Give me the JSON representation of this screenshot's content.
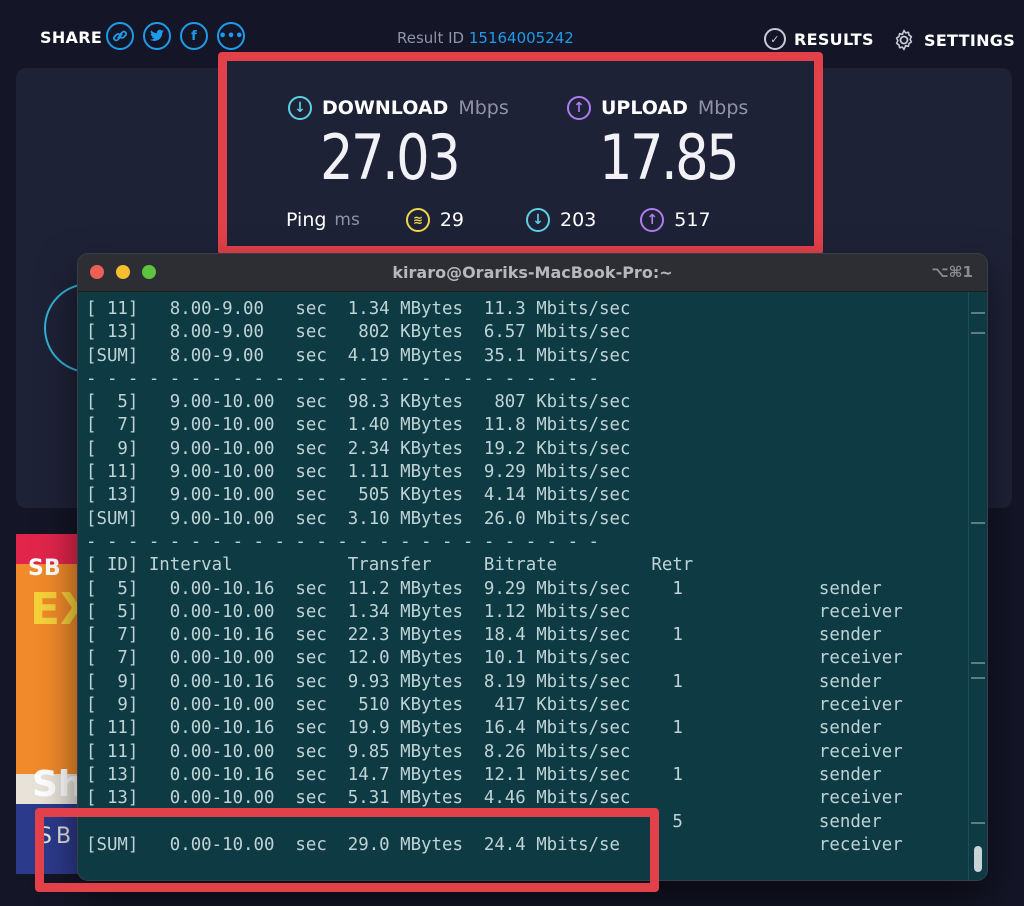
{
  "topbar": {
    "share_label": "SHARE",
    "share_icons": [
      "link-icon",
      "twitter-icon",
      "facebook-icon",
      "more-icon"
    ],
    "result_id_label": "Result ID",
    "result_id_value": "15164005242",
    "results_label": "RESULTS",
    "settings_label": "SETTINGS"
  },
  "speed": {
    "download_label": "DOWNLOAD",
    "download_unit": "Mbps",
    "download_value": "27.03",
    "upload_label": "UPLOAD",
    "upload_unit": "Mbps",
    "upload_value": "17.85",
    "ping_label": "Ping",
    "ping_unit": "ms",
    "ping_idle": "29",
    "ping_download": "203",
    "ping_upload": "517"
  },
  "ad": {
    "text_top": "SB",
    "text_big": "EX",
    "text_sh": "Sh",
    "text_bottom": "SBI"
  },
  "terminal": {
    "title": "kiraro@Orariks-MacBook-Pro:~",
    "shortcut": "⌥⌘1",
    "lines": [
      "[ 11]   8.00-9.00   sec  1.34 MBytes  11.3 Mbits/sec",
      "[ 13]   8.00-9.00   sec   802 KBytes  6.57 Mbits/sec",
      "[SUM]   8.00-9.00   sec  4.19 MBytes  35.1 Mbits/sec",
      "- - - - - - - - - - - - - - - - - - - - - - - - -",
      "[  5]   9.00-10.00  sec  98.3 KBytes   807 Kbits/sec",
      "[  7]   9.00-10.00  sec  1.40 MBytes  11.8 Mbits/sec",
      "[  9]   9.00-10.00  sec  2.34 KBytes  19.2 Kbits/sec",
      "[ 11]   9.00-10.00  sec  1.11 MBytes  9.29 Mbits/sec",
      "[ 13]   9.00-10.00  sec   505 KBytes  4.14 Mbits/sec",
      "[SUM]   9.00-10.00  sec  3.10 MBytes  26.0 Mbits/sec",
      "- - - - - - - - - - - - - - - - - - - - - - - - -",
      "[ ID] Interval           Transfer     Bitrate         Retr",
      "[  5]   0.00-10.16  sec  11.2 MBytes  9.29 Mbits/sec    1             sender",
      "[  5]   0.00-10.00  sec  1.34 MBytes  1.12 Mbits/sec                  receiver",
      "[  7]   0.00-10.16  sec  22.3 MBytes  18.4 Mbits/sec    1             sender",
      "[  7]   0.00-10.00  sec  12.0 MBytes  10.1 Mbits/sec                  receiver",
      "[  9]   0.00-10.16  sec  9.93 MBytes  8.19 Mbits/sec    1             sender",
      "[  9]   0.00-10.00  sec   510 KBytes   417 Kbits/sec                  receiver",
      "[ 11]   0.00-10.16  sec  19.9 MBytes  16.4 Mbits/sec    1             sender",
      "[ 11]   0.00-10.00  sec  9.85 MBytes  8.26 Mbits/sec                  receiver",
      "[ 13]   0.00-10.16  sec  14.7 MBytes  12.1 Mbits/sec    1             sender",
      "[ 13]   0.00-10.00  sec  5.31 MBytes  4.46 Mbits/sec                  receiver",
      "                                                        5             sender",
      "[SUM]   0.00-10.00  sec  29.0 MBytes  24.4 Mbits/se                   receiver"
    ]
  },
  "colors": {
    "background": "#141526",
    "panel": "#1e2236",
    "accent_blue": "#1e9bea",
    "download_teal": "#5fd0e4",
    "upload_purple": "#b07cf2",
    "ping_yellow": "#f1d64d",
    "highlight_red": "#e24149",
    "terminal_bg": "#0e3b43",
    "terminal_text": "#bfd3d6"
  }
}
